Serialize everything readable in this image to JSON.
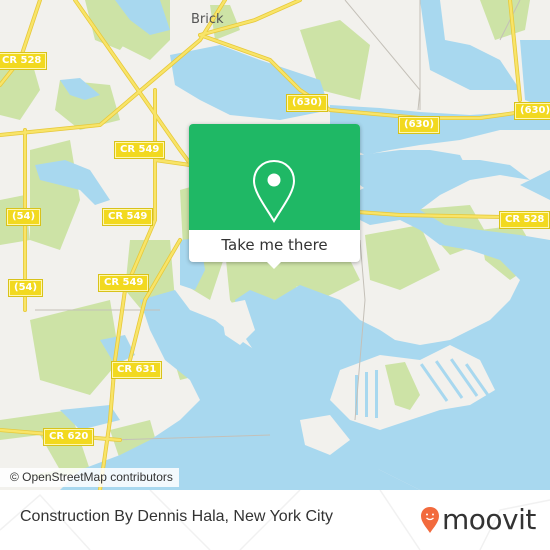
{
  "map": {
    "colors": {
      "land": "#f2f1ed",
      "water": "#a8d8ef",
      "park": "#cde3a6",
      "road": "#f5dd5a",
      "road_casing": "#e7c93a",
      "minor_road": "#bbbbbb"
    },
    "place_labels": [
      {
        "name": "Brick"
      }
    ],
    "road_shields": [
      {
        "label": "CR 528"
      },
      {
        "label": "CR 549"
      },
      {
        "label": "CR 549"
      },
      {
        "label": "(54)"
      },
      {
        "label": "(54)"
      },
      {
        "label": "CR 549"
      },
      {
        "label": "(630)"
      },
      {
        "label": "(630)"
      },
      {
        "label": "(630)"
      },
      {
        "label": "CR 528"
      },
      {
        "label": "CR 631"
      },
      {
        "label": "CR 620"
      }
    ],
    "attribution": "© OpenStreetMap contributors"
  },
  "popup": {
    "icon": "location-pin-icon",
    "button_label": "Take me there",
    "color": "#1fb865"
  },
  "footer": {
    "title": "Construction By Dennis Hala, New York City",
    "brand": "moovit",
    "brand_color": "#f26a3d"
  }
}
